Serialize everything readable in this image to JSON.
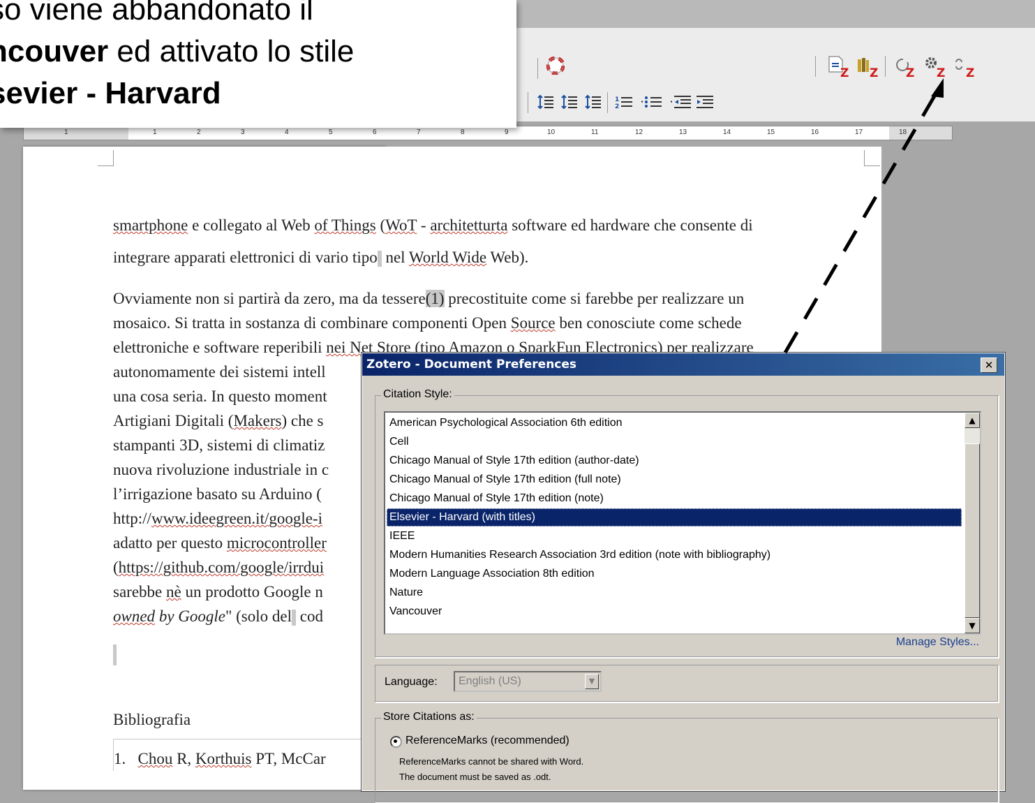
{
  "callout": {
    "line1": "so viene abbandonato il",
    "line2_bold": "ncouver",
    "line2_rest": " ed attivato lo stile",
    "line3_bold": "sevier - Harvard"
  },
  "ruler": {
    "ticks": [
      "1",
      "1",
      "2",
      "3",
      "4",
      "5",
      "6",
      "7",
      "8",
      "9",
      "10",
      "11",
      "12",
      "13",
      "14",
      "15",
      "16",
      "17",
      "18"
    ]
  },
  "document": {
    "p1_a": "smartphone",
    "p1_b": " e collegato al Web ",
    "p1_c": "of Things",
    "p1_d": " (",
    "p1_e": "WoT",
    "p1_f": " - ",
    "p1_g": "architetturta",
    "p1_h": " software ed hardware che consente di",
    "p1_line2a": "integrare apparati elettronici di vario tipo",
    "p1_line2b": " nel ",
    "p1_line2c": "World Wide",
    "p1_line2d": " Web).",
    "p2_l1a": "Ovviamente non si partirà da zero, ma da tessere",
    "p2_l1b": "(1)",
    "p2_l1c": "  precostituite come si farebbe per realizzare un",
    "p2_l2a": "mosaico. Si tratta in sostanza di combinare componenti Open ",
    "p2_l2b": "Source",
    "p2_l2c": " ben conosciute come schede",
    "p2_l3a": "elettroniche e software reperibili ",
    "p2_l3b": "nei Net Store (tipo Amazon o SparkFun Electronics) per realizzare",
    "p2_l4": "autonomamente dei sistemi intell",
    "p2_l5": "una cosa seria. In questo moment",
    "p2_l6a": "Artigiani Digitali (",
    "p2_l6b": "Makers",
    "p2_l6c": ") che s",
    "p2_l7": "stampanti 3D, sistemi di climatiz",
    "p2_l8": "nuova rivoluzione industriale in c",
    "p2_l9": "l’irrigazione basato su Arduino (",
    "p2_l10a": "http://",
    "p2_l10b": "www.ideegreen.it/google-i",
    "p2_l11a": "adatto per questo ",
    "p2_l11b": "microcontroller",
    "p2_l12a": "(",
    "p2_l12b": "https://github.com/google/irrdui",
    "p2_l13a": "sarebbe ",
    "p2_l13b": "nè",
    "p2_l13c": " un prodotto Google n",
    "p2_l14a": "owned",
    "p2_l14b": " by Google",
    "p2_l14c": "\" (solo del",
    "p2_l14d": " cod",
    "bibliography_heading": "Bibliografia",
    "bib1_num": "1.",
    "bib1_a": "Chou",
    "bib1_b": " R, ",
    "bib1_c": "Korthuis",
    "bib1_d": " PT, McCar"
  },
  "dialog": {
    "title": "Zotero - Document Preferences",
    "close": "✕",
    "citation_style_label": "Citation Style:",
    "styles": [
      "American Psychological Association 6th edition",
      "Cell",
      "Chicago Manual of Style 17th edition (author-date)",
      "Chicago Manual of Style 17th edition (full note)",
      "Chicago Manual of Style 17th edition (note)",
      "Elsevier - Harvard (with titles)",
      "IEEE",
      "Modern Humanities Research Association 3rd edition (note with bibliography)",
      "Modern Language Association 8th edition",
      "Nature",
      "Vancouver"
    ],
    "selected_style": "Elsevier - Harvard (with titles)",
    "manage_styles": "Manage Styles...",
    "language_label": "Language:",
    "language_value": "English (US)",
    "store_label": "Store Citations as:",
    "radio_label": "ReferenceMarks (recommended)",
    "note1": "ReferenceMarks cannot be shared with Word.",
    "note2": "The document must be saved as .odt."
  },
  "colors": {
    "dialog_bg": "#d4d0c8",
    "titlebar": "#0a246a",
    "selection": "#0a246a",
    "link": "#1a3e8c",
    "zotero_red": "#d11a1a"
  },
  "icons": [
    "help-icon",
    "list-indent-icon",
    "numbering-icon",
    "bullets-icon",
    "zotero-add-edit-citation-icon",
    "zotero-add-bibliography-icon",
    "zotero-refresh-icon",
    "zotero-document-preferences-icon",
    "zotero-unlink-citations-icon",
    "arrow-pointer"
  ]
}
